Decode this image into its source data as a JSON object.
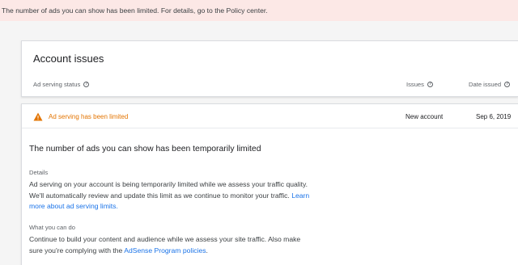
{
  "banner": {
    "text": "The number of ads you can show has been limited. For details, go to the Policy center."
  },
  "issues": {
    "title": "Account issues",
    "columns": {
      "status": "Ad serving status",
      "issues": "Issues",
      "date": "Date issued"
    }
  },
  "issue_row": {
    "status": "Ad serving has been limited",
    "issue": "New account",
    "date": "Sep 6, 2019"
  },
  "detail": {
    "heading": "The number of ads you can show has been temporarily limited",
    "details_label": "Details",
    "details_text": "Ad serving on your account is being temporarily limited while we assess your traffic quality. We'll automatically review and update this limit as we continue to monitor your traffic.",
    "details_link": "Learn more about ad serving limits.",
    "action_label": "What you can do",
    "action_text": "Continue to build your content and audience while we assess your site traffic. Also make sure you're complying with the",
    "action_link": "AdSense Program policies",
    "action_end": "."
  },
  "colors": {
    "banner_bg": "#fce8e6",
    "warning": "#e37400",
    "link": "#1a73e8"
  },
  "icons": [
    "help-icon",
    "warning-icon"
  ]
}
